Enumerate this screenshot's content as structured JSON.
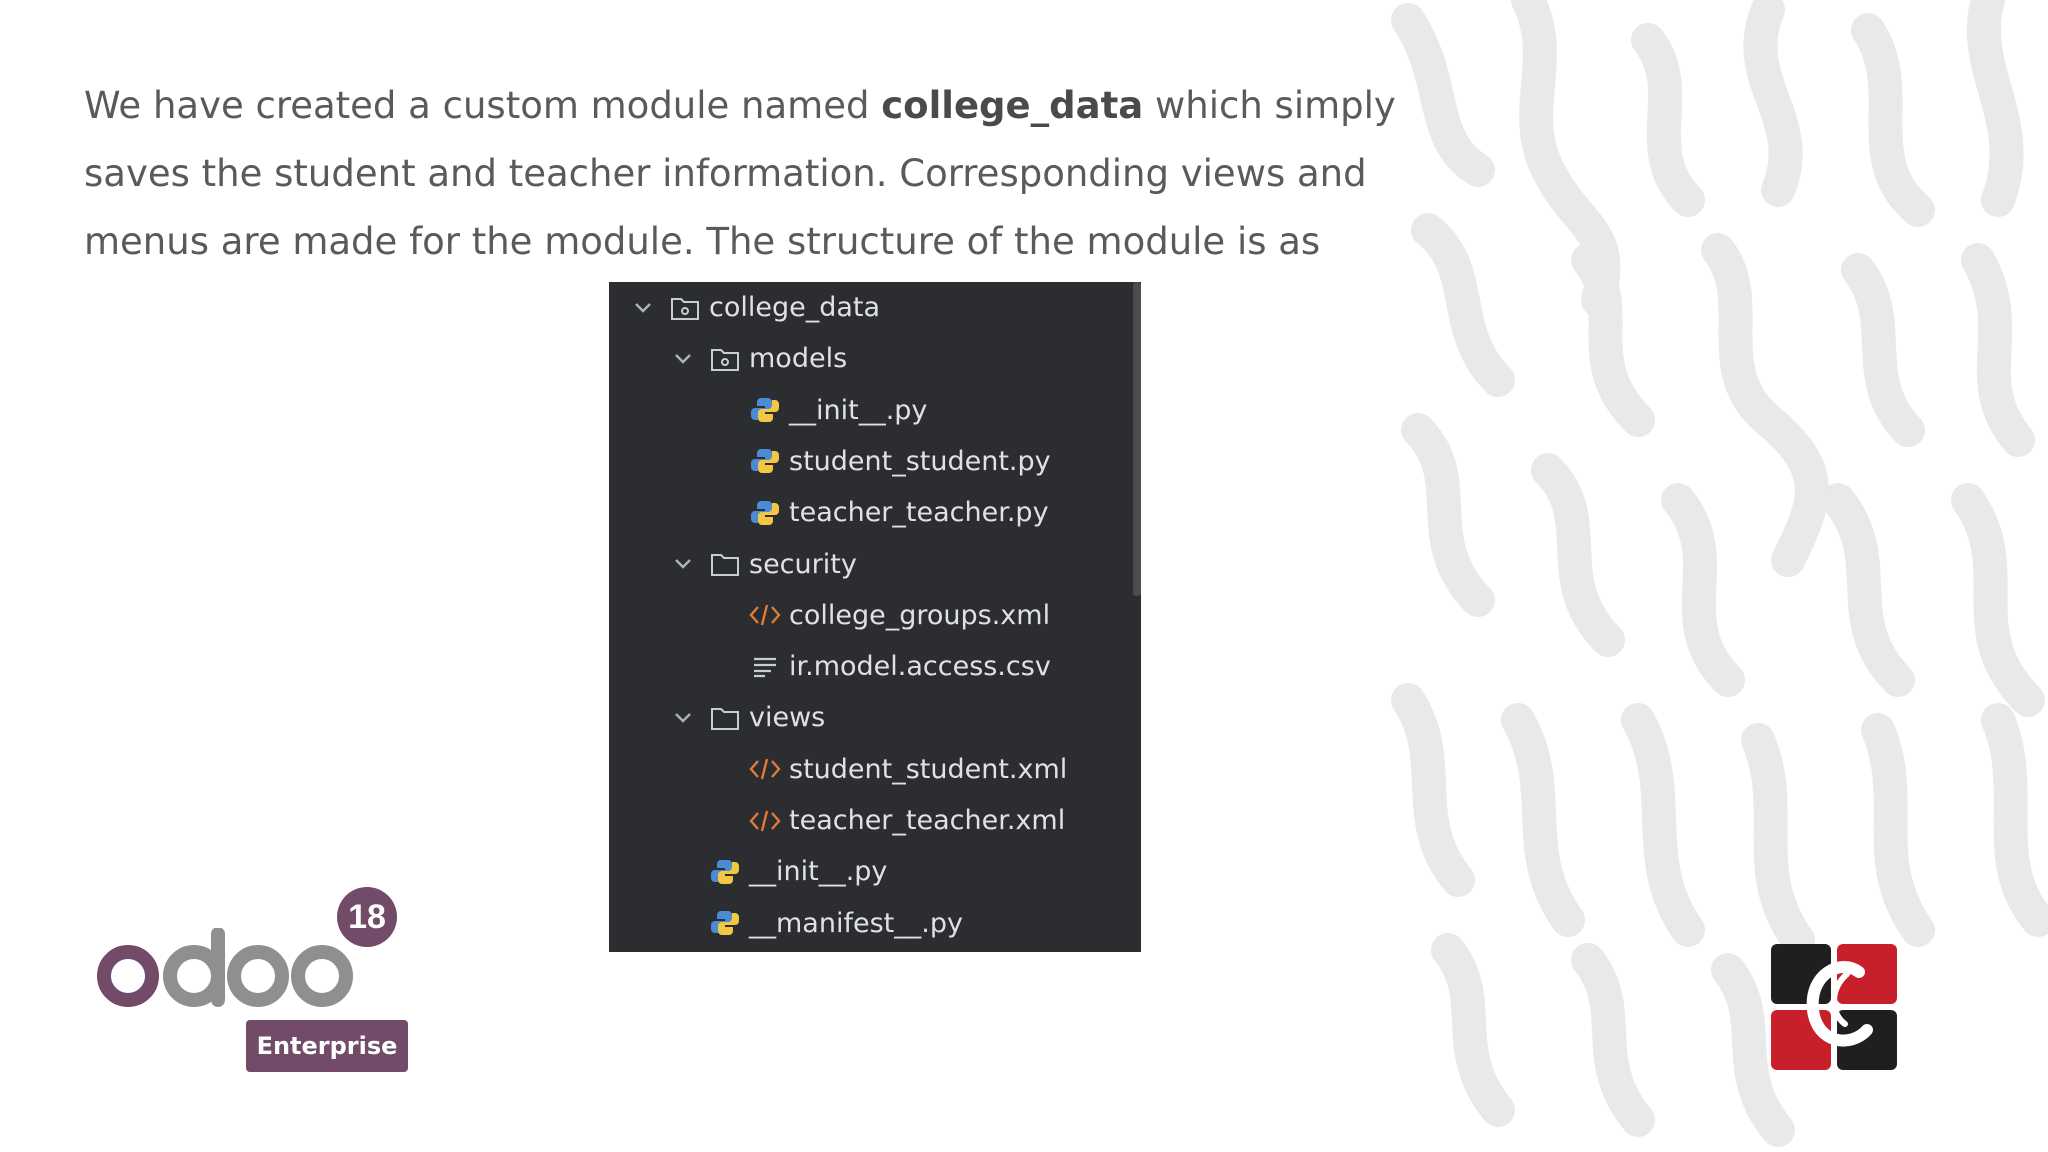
{
  "intro": {
    "line_a": "We have created a custom module named ",
    "bold": "college_data",
    "line_b": " which simply saves the student and teacher information. Corresponding views and menus are made for the module. The structure of the module is as"
  },
  "tree": [
    {
      "label": "college_data",
      "icon": "package-folder-icon",
      "level": 0,
      "expanded": true
    },
    {
      "label": "models",
      "icon": "package-folder-icon",
      "level": 1,
      "expanded": true
    },
    {
      "label": "__init__.py",
      "icon": "python-file-icon",
      "level": 2
    },
    {
      "label": "student_student.py",
      "icon": "python-file-icon",
      "level": 2
    },
    {
      "label": "teacher_teacher.py",
      "icon": "python-file-icon",
      "level": 2
    },
    {
      "label": "security",
      "icon": "folder-icon",
      "level": 1,
      "expanded": true
    },
    {
      "label": "college_groups.xml",
      "icon": "xml-file-icon",
      "level": 2
    },
    {
      "label": "ir.model.access.csv",
      "icon": "text-file-icon",
      "level": 2
    },
    {
      "label": "views",
      "icon": "folder-icon",
      "level": 1,
      "expanded": true
    },
    {
      "label": "student_student.xml",
      "icon": "xml-file-icon",
      "level": 2
    },
    {
      "label": "teacher_teacher.xml",
      "icon": "xml-file-icon",
      "level": 2
    },
    {
      "label": "__init__.py",
      "icon": "python-file-icon",
      "level": 1
    },
    {
      "label": "__manifest__.py",
      "icon": "python-file-icon",
      "level": 1
    }
  ],
  "branding": {
    "odoo_word": "odoo",
    "version": "18",
    "edition": "Enterprise"
  },
  "colors": {
    "odoo_purple": "#714b67",
    "odoo_grey": "#8f8f8f",
    "tree_bg": "#2b2d30",
    "tree_text": "#dfe1e5",
    "xml_orange": "#e07b39",
    "python_blue": "#4b8bd4",
    "python_yellow": "#f2c744"
  }
}
